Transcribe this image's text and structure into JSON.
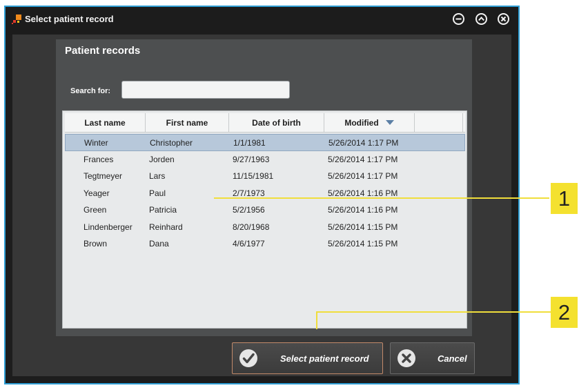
{
  "window": {
    "title": "Select patient record"
  },
  "panel": {
    "title": "Patient records",
    "search_label": "Search for:",
    "search_value": "",
    "search_placeholder": ""
  },
  "table": {
    "columns": [
      "Last name",
      "First name",
      "Date of birth",
      "Modified",
      ""
    ],
    "sorted_column": "Modified",
    "sort_direction": "descending",
    "selected_row": 0,
    "rows": [
      [
        "Winter",
        "Christopher",
        "1/1/1981",
        "5/26/2014 1:17 PM"
      ],
      [
        "Frances",
        "Jorden",
        "9/27/1963",
        "5/26/2014 1:17 PM"
      ],
      [
        "Tegtmeyer",
        "Lars",
        "11/15/1981",
        "5/26/2014 1:17 PM"
      ],
      [
        "Yeager",
        "Paul",
        "2/7/1973",
        "5/26/2014 1:16 PM"
      ],
      [
        "Green",
        "Patricia",
        "5/2/1956",
        "5/26/2014 1:16 PM"
      ],
      [
        "Lindenberger",
        "Reinhard",
        "8/20/1968",
        "5/26/2014 1:15 PM"
      ],
      [
        "Brown",
        "Dana",
        "4/6/1977",
        "5/26/2014 1:15 PM"
      ]
    ]
  },
  "buttons": {
    "select_label": "Select patient record",
    "select_icon": "checkmark-icon",
    "cancel_label": "Cancel",
    "cancel_icon": "x-icon"
  },
  "callouts": [
    {
      "label": "1"
    },
    {
      "label": "2"
    }
  ],
  "colors": {
    "window_border": "#2f9fd6",
    "selected_row": "#b7c8da",
    "callout": "#f4e12f",
    "primary_button_border": "#c38a6a"
  }
}
